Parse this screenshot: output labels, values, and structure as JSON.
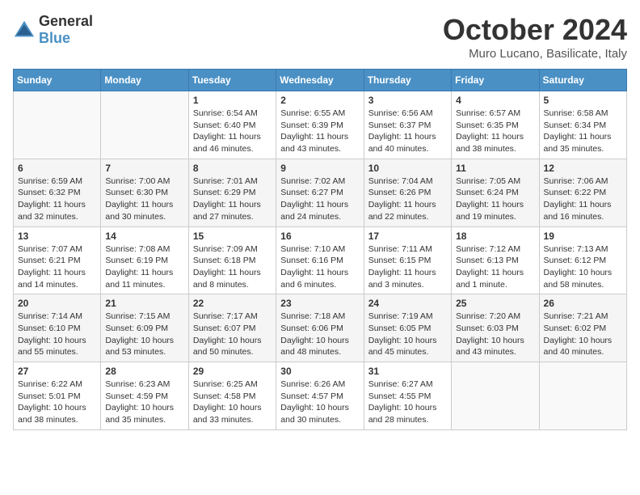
{
  "header": {
    "logo_line1": "General",
    "logo_line2": "Blue",
    "month_title": "October 2024",
    "location": "Muro Lucano, Basilicate, Italy"
  },
  "weekdays": [
    "Sunday",
    "Monday",
    "Tuesday",
    "Wednesday",
    "Thursday",
    "Friday",
    "Saturday"
  ],
  "weeks": [
    [
      {
        "day": "",
        "sunrise": "",
        "sunset": "",
        "daylight": ""
      },
      {
        "day": "",
        "sunrise": "",
        "sunset": "",
        "daylight": ""
      },
      {
        "day": "1",
        "sunrise": "Sunrise: 6:54 AM",
        "sunset": "Sunset: 6:40 PM",
        "daylight": "Daylight: 11 hours and 46 minutes."
      },
      {
        "day": "2",
        "sunrise": "Sunrise: 6:55 AM",
        "sunset": "Sunset: 6:39 PM",
        "daylight": "Daylight: 11 hours and 43 minutes."
      },
      {
        "day": "3",
        "sunrise": "Sunrise: 6:56 AM",
        "sunset": "Sunset: 6:37 PM",
        "daylight": "Daylight: 11 hours and 40 minutes."
      },
      {
        "day": "4",
        "sunrise": "Sunrise: 6:57 AM",
        "sunset": "Sunset: 6:35 PM",
        "daylight": "Daylight: 11 hours and 38 minutes."
      },
      {
        "day": "5",
        "sunrise": "Sunrise: 6:58 AM",
        "sunset": "Sunset: 6:34 PM",
        "daylight": "Daylight: 11 hours and 35 minutes."
      }
    ],
    [
      {
        "day": "6",
        "sunrise": "Sunrise: 6:59 AM",
        "sunset": "Sunset: 6:32 PM",
        "daylight": "Daylight: 11 hours and 32 minutes."
      },
      {
        "day": "7",
        "sunrise": "Sunrise: 7:00 AM",
        "sunset": "Sunset: 6:30 PM",
        "daylight": "Daylight: 11 hours and 30 minutes."
      },
      {
        "day": "8",
        "sunrise": "Sunrise: 7:01 AM",
        "sunset": "Sunset: 6:29 PM",
        "daylight": "Daylight: 11 hours and 27 minutes."
      },
      {
        "day": "9",
        "sunrise": "Sunrise: 7:02 AM",
        "sunset": "Sunset: 6:27 PM",
        "daylight": "Daylight: 11 hours and 24 minutes."
      },
      {
        "day": "10",
        "sunrise": "Sunrise: 7:04 AM",
        "sunset": "Sunset: 6:26 PM",
        "daylight": "Daylight: 11 hours and 22 minutes."
      },
      {
        "day": "11",
        "sunrise": "Sunrise: 7:05 AM",
        "sunset": "Sunset: 6:24 PM",
        "daylight": "Daylight: 11 hours and 19 minutes."
      },
      {
        "day": "12",
        "sunrise": "Sunrise: 7:06 AM",
        "sunset": "Sunset: 6:22 PM",
        "daylight": "Daylight: 11 hours and 16 minutes."
      }
    ],
    [
      {
        "day": "13",
        "sunrise": "Sunrise: 7:07 AM",
        "sunset": "Sunset: 6:21 PM",
        "daylight": "Daylight: 11 hours and 14 minutes."
      },
      {
        "day": "14",
        "sunrise": "Sunrise: 7:08 AM",
        "sunset": "Sunset: 6:19 PM",
        "daylight": "Daylight: 11 hours and 11 minutes."
      },
      {
        "day": "15",
        "sunrise": "Sunrise: 7:09 AM",
        "sunset": "Sunset: 6:18 PM",
        "daylight": "Daylight: 11 hours and 8 minutes."
      },
      {
        "day": "16",
        "sunrise": "Sunrise: 7:10 AM",
        "sunset": "Sunset: 6:16 PM",
        "daylight": "Daylight: 11 hours and 6 minutes."
      },
      {
        "day": "17",
        "sunrise": "Sunrise: 7:11 AM",
        "sunset": "Sunset: 6:15 PM",
        "daylight": "Daylight: 11 hours and 3 minutes."
      },
      {
        "day": "18",
        "sunrise": "Sunrise: 7:12 AM",
        "sunset": "Sunset: 6:13 PM",
        "daylight": "Daylight: 11 hours and 1 minute."
      },
      {
        "day": "19",
        "sunrise": "Sunrise: 7:13 AM",
        "sunset": "Sunset: 6:12 PM",
        "daylight": "Daylight: 10 hours and 58 minutes."
      }
    ],
    [
      {
        "day": "20",
        "sunrise": "Sunrise: 7:14 AM",
        "sunset": "Sunset: 6:10 PM",
        "daylight": "Daylight: 10 hours and 55 minutes."
      },
      {
        "day": "21",
        "sunrise": "Sunrise: 7:15 AM",
        "sunset": "Sunset: 6:09 PM",
        "daylight": "Daylight: 10 hours and 53 minutes."
      },
      {
        "day": "22",
        "sunrise": "Sunrise: 7:17 AM",
        "sunset": "Sunset: 6:07 PM",
        "daylight": "Daylight: 10 hours and 50 minutes."
      },
      {
        "day": "23",
        "sunrise": "Sunrise: 7:18 AM",
        "sunset": "Sunset: 6:06 PM",
        "daylight": "Daylight: 10 hours and 48 minutes."
      },
      {
        "day": "24",
        "sunrise": "Sunrise: 7:19 AM",
        "sunset": "Sunset: 6:05 PM",
        "daylight": "Daylight: 10 hours and 45 minutes."
      },
      {
        "day": "25",
        "sunrise": "Sunrise: 7:20 AM",
        "sunset": "Sunset: 6:03 PM",
        "daylight": "Daylight: 10 hours and 43 minutes."
      },
      {
        "day": "26",
        "sunrise": "Sunrise: 7:21 AM",
        "sunset": "Sunset: 6:02 PM",
        "daylight": "Daylight: 10 hours and 40 minutes."
      }
    ],
    [
      {
        "day": "27",
        "sunrise": "Sunrise: 6:22 AM",
        "sunset": "Sunset: 5:01 PM",
        "daylight": "Daylight: 10 hours and 38 minutes."
      },
      {
        "day": "28",
        "sunrise": "Sunrise: 6:23 AM",
        "sunset": "Sunset: 4:59 PM",
        "daylight": "Daylight: 10 hours and 35 minutes."
      },
      {
        "day": "29",
        "sunrise": "Sunrise: 6:25 AM",
        "sunset": "Sunset: 4:58 PM",
        "daylight": "Daylight: 10 hours and 33 minutes."
      },
      {
        "day": "30",
        "sunrise": "Sunrise: 6:26 AM",
        "sunset": "Sunset: 4:57 PM",
        "daylight": "Daylight: 10 hours and 30 minutes."
      },
      {
        "day": "31",
        "sunrise": "Sunrise: 6:27 AM",
        "sunset": "Sunset: 4:55 PM",
        "daylight": "Daylight: 10 hours and 28 minutes."
      },
      {
        "day": "",
        "sunrise": "",
        "sunset": "",
        "daylight": ""
      },
      {
        "day": "",
        "sunrise": "",
        "sunset": "",
        "daylight": ""
      }
    ]
  ]
}
